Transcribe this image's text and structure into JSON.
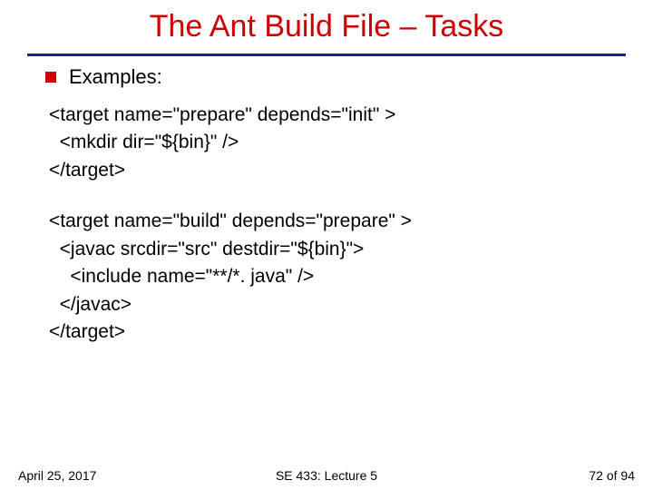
{
  "title": "The Ant Build File – Tasks",
  "bullet_label": "Examples:",
  "code_block1": "<target name=\"prepare\" depends=\"init\" >\n  <mkdir dir=\"${bin}\" />\n</target>",
  "code_block2": "<target name=\"build\" depends=\"prepare\" >\n  <javac srcdir=\"src\" destdir=\"${bin}\">\n    <include name=\"**/*. java\" />\n  </javac>\n</target>",
  "footer": {
    "date": "April 25, 2017",
    "course": "SE 433: Lecture 5",
    "page": "72 of 94"
  }
}
